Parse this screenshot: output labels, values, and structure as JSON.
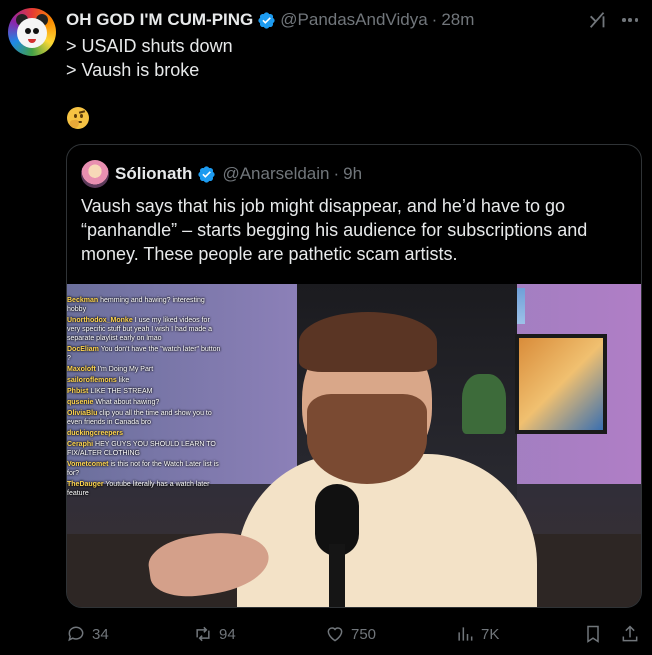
{
  "post": {
    "author_name": "OH GOD I'M CUM-PING",
    "author_handle": "@PandasAndVidya",
    "separator": "·",
    "time": "28m",
    "lines": [
      "> USAID shuts down",
      "> Vaush is broke"
    ],
    "emoji": "thinking-face"
  },
  "quote": {
    "author_name": "Sólionath",
    "author_handle": "@Anarseldain",
    "separator": "·",
    "time": "9h",
    "text": "Vaush says that his job might disappear, and he’d have to go “panhandle” – starts begging his audience for subscriptions and money. These people are pathetic scam artists."
  },
  "video": {
    "chat": [
      {
        "user": "Beckman",
        "msg": "hemming and hawing? interesting hobby"
      },
      {
        "user": "Unorthodox_Monke",
        "msg": "I use my liked videos for very specific stuff but yeah I wish I had made a separate playlist early on lmao"
      },
      {
        "user": "DocEliam",
        "msg": "You don't have the \"watch later\" button ?"
      },
      {
        "user": "Maxoloft",
        "msg": "I'm Doing My Part"
      },
      {
        "user": "sailoroflemons",
        "msg": "like"
      },
      {
        "user": "Phbist",
        "msg": "LIKE THE STREAM"
      },
      {
        "user": "qusenie",
        "msg": "What about hawing?"
      },
      {
        "user": "OliviaBlu",
        "msg": "clip you all the time and show you to even friends in Canada bro"
      },
      {
        "user": "duckingcreepers",
        "msg": ""
      },
      {
        "user": "Ceraphi",
        "msg": "HEY GUYS YOU SHOULD LEARN TO FIX/ALTER CLOTHING"
      },
      {
        "user": "Vometcomet",
        "msg": "is this not for the Watch Later list is for?"
      },
      {
        "user": "TheDauger",
        "msg": "Youtube literally has a watch later feature"
      }
    ]
  },
  "actions": {
    "replies": "34",
    "reposts": "94",
    "likes": "750",
    "views": "7K"
  },
  "colors": {
    "background": "#000000",
    "text": "#e7e9ea",
    "muted": "#71767b",
    "verified": "#1d9bf0",
    "border": "#2f3336"
  }
}
